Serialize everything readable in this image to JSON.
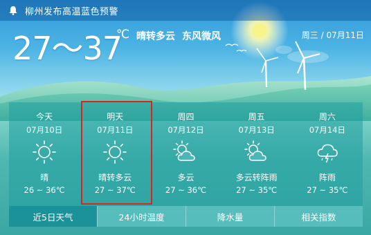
{
  "alert": {
    "text": "柳州发布高温蓝色预警",
    "icon": "bell-icon"
  },
  "current": {
    "temp_range": "27～37",
    "unit": "℃",
    "condition": "晴转多云",
    "wind": "东风微风",
    "date": "周三 / 07月11日"
  },
  "forecast": [
    {
      "day": "今天",
      "date": "07月10日",
      "icon": "sunny-icon",
      "condition": "晴",
      "temp": "26 ~ 36℃"
    },
    {
      "day": "明天",
      "date": "07月11日",
      "icon": "sunny-icon",
      "condition": "晴转多云",
      "temp": "27 ~ 37℃"
    },
    {
      "day": "周四",
      "date": "07月12日",
      "icon": "partly-cloudy-icon",
      "condition": "多云",
      "temp": "27 ~ 36℃"
    },
    {
      "day": "周五",
      "date": "07月13日",
      "icon": "partly-cloudy-icon",
      "condition": "多云转阵雨",
      "temp": "27 ~ 35℃"
    },
    {
      "day": "周六",
      "date": "07月14日",
      "icon": "thunder-rain-icon",
      "condition": "阵雨",
      "temp": "27 ~ 35℃"
    }
  ],
  "tabs": [
    {
      "label": "近5日天气",
      "active": true
    },
    {
      "label": "24小时温度",
      "active": false
    },
    {
      "label": "降水量",
      "active": false
    },
    {
      "label": "相关指数",
      "active": false
    }
  ],
  "colors": {
    "selection_border": "#d9251c",
    "sun": "#f6f48a"
  }
}
